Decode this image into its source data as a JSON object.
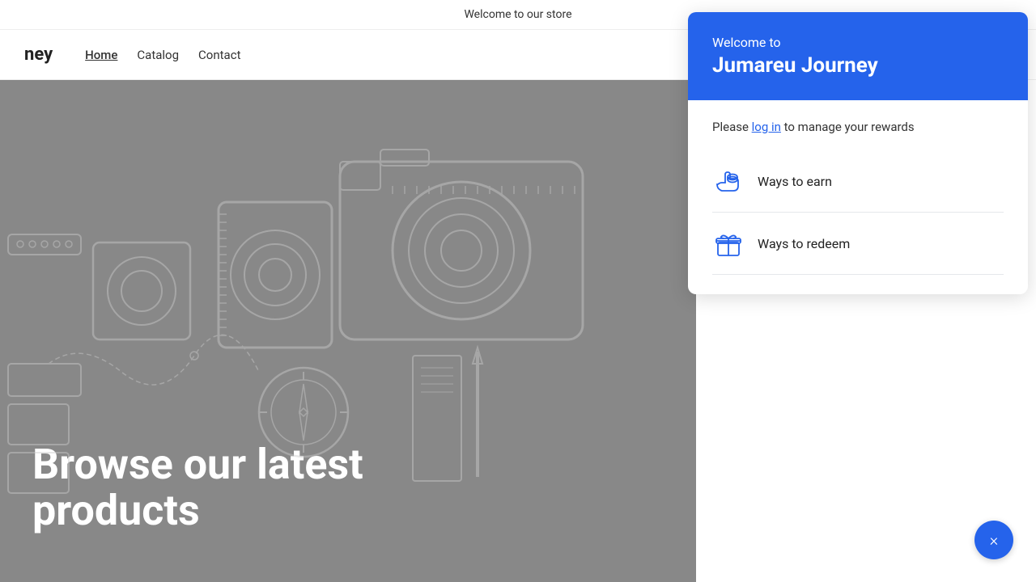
{
  "announcement": {
    "text": "Welcome to our store"
  },
  "nav": {
    "logo": "ney",
    "links": [
      {
        "label": "Home",
        "active": true
      },
      {
        "label": "Catalog",
        "active": false
      },
      {
        "label": "Contact",
        "active": false
      }
    ]
  },
  "hero": {
    "tagline": "Browse our latest products"
  },
  "rewards_panel": {
    "header": {
      "welcome_to": "Welcome to",
      "brand_name": "Jumareu Journey"
    },
    "body": {
      "login_prefix": "Please ",
      "login_link": "log in",
      "login_suffix": " to manage your rewards",
      "items": [
        {
          "id": "earn",
          "label": "Ways to earn"
        },
        {
          "id": "redeem",
          "label": "Ways to redeem"
        }
      ]
    }
  },
  "float_button": {
    "label": "×"
  },
  "colors": {
    "accent": "#2563EB"
  }
}
